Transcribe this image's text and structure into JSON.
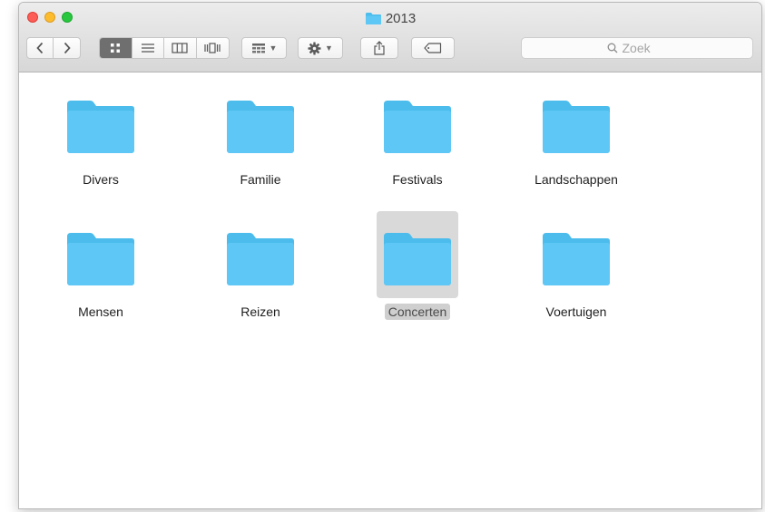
{
  "window": {
    "title": "2013"
  },
  "search": {
    "placeholder": "Zoek"
  },
  "folders": [
    {
      "label": "Divers"
    },
    {
      "label": "Familie"
    },
    {
      "label": "Festivals"
    },
    {
      "label": "Landschappen"
    },
    {
      "label": "Mensen"
    },
    {
      "label": "Reizen"
    },
    {
      "label": "Concerten",
      "selected": true
    },
    {
      "label": "Voertuigen"
    }
  ],
  "colors": {
    "folder": "#5ec7f5",
    "folder_tab": "#4bbcec",
    "selection": "#d9d9d9",
    "close": "#fc5d57",
    "minimize": "#fdbb2e",
    "maximize": "#29c73f"
  },
  "icons": {
    "back": "chevron-left-icon",
    "forward": "chevron-right-icon",
    "icon_view": "grid-icon",
    "list_view": "list-icon",
    "column_view": "columns-icon",
    "coverflow_view": "coverflow-icon",
    "arrange": "arrange-icon",
    "action": "gear-icon",
    "share": "share-icon",
    "tags": "tag-icon",
    "search": "search-icon"
  }
}
